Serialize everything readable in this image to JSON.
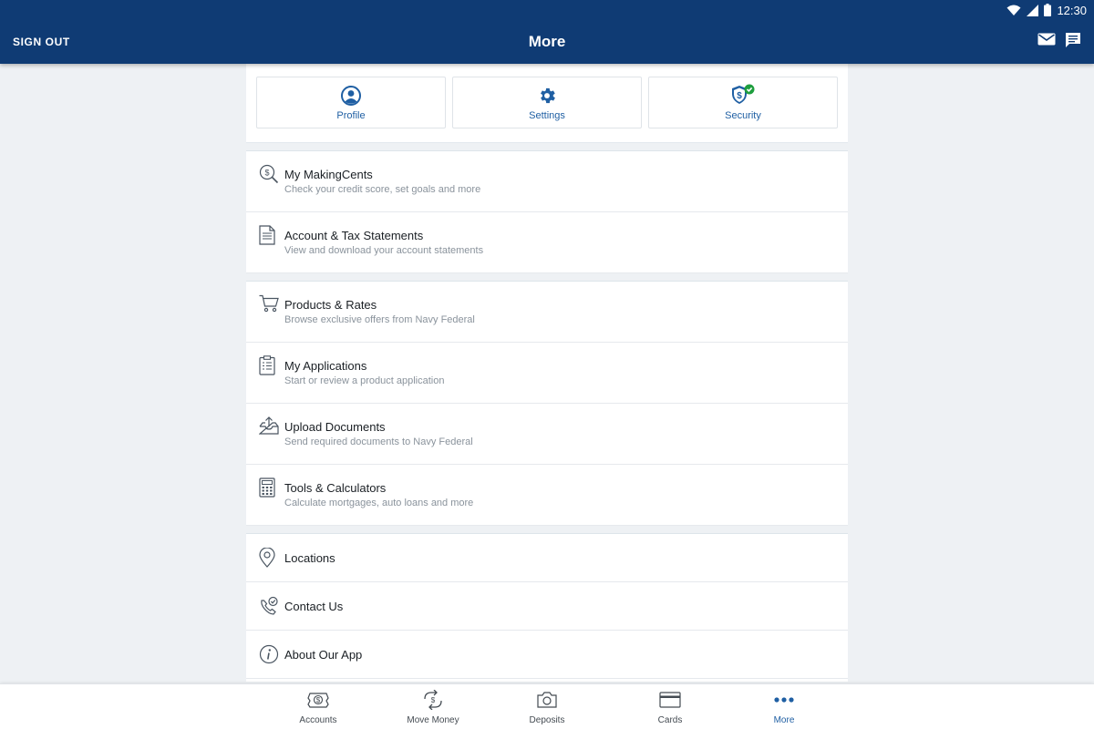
{
  "status_bar": {
    "time": "12:30"
  },
  "header": {
    "sign_out": "SIGN OUT",
    "title": "More"
  },
  "quick_actions": [
    {
      "label": "Profile",
      "icon": "profile-icon"
    },
    {
      "label": "Settings",
      "icon": "gear-icon"
    },
    {
      "label": "Security",
      "icon": "shield-check-icon"
    }
  ],
  "group1": [
    {
      "title": "My MakingCents",
      "subtitle": "Check your credit score, set goals and more",
      "icon": "dollar-search-icon"
    },
    {
      "title": "Account & Tax Statements",
      "subtitle": "View and download your account statements",
      "icon": "document-icon"
    }
  ],
  "group2": [
    {
      "title": "Products & Rates",
      "subtitle": "Browse exclusive offers from Navy Federal",
      "icon": "cart-icon"
    },
    {
      "title": "My Applications",
      "subtitle": "Start or review a product application",
      "icon": "clipboard-icon"
    },
    {
      "title": "Upload Documents",
      "subtitle": "Send required documents to Navy Federal",
      "icon": "upload-tray-icon"
    },
    {
      "title": "Tools & Calculators",
      "subtitle": "Calculate mortgages, auto loans and more",
      "icon": "calculator-icon"
    }
  ],
  "group3": [
    {
      "title": "Locations",
      "icon": "location-pin-icon"
    },
    {
      "title": "Contact Us",
      "icon": "phone-check-icon"
    },
    {
      "title": "About Our App",
      "icon": "info-icon"
    }
  ],
  "bottom_nav": [
    {
      "label": "Accounts",
      "icon": "dollar-box-icon"
    },
    {
      "label": "Move Money",
      "icon": "transfer-icon"
    },
    {
      "label": "Deposits",
      "icon": "camera-icon"
    },
    {
      "label": "Cards",
      "icon": "card-icon"
    },
    {
      "label": "More",
      "icon": "more-dots-icon",
      "active": true
    }
  ],
  "colors": {
    "header": "#0f3b74",
    "accent": "#1f5fa3",
    "check_green": "#1e9e3e"
  }
}
